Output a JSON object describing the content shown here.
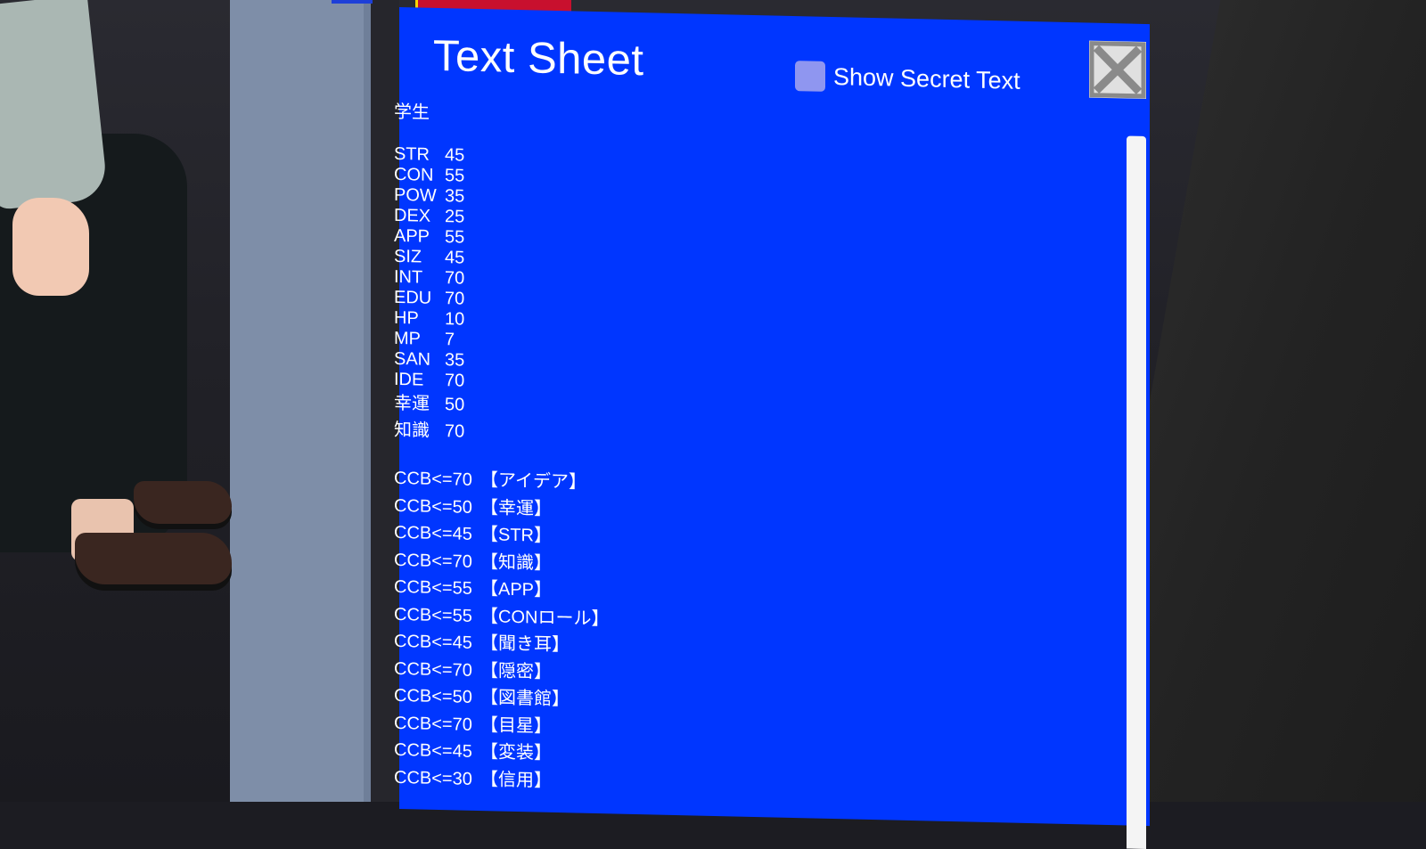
{
  "window": {
    "title": "Text Sheet",
    "secret_toggle_label": "Show Secret Text",
    "secret_toggle_checked": false,
    "close_icon": "close-x-icon"
  },
  "sheet": {
    "name": "学生",
    "stats": [
      {
        "key": "STR",
        "value": "45"
      },
      {
        "key": "CON",
        "value": "55"
      },
      {
        "key": "POW",
        "value": "35"
      },
      {
        "key": "DEX",
        "value": "25"
      },
      {
        "key": "APP",
        "value": "55"
      },
      {
        "key": "SIZ",
        "value": "45"
      },
      {
        "key": "INT",
        "value": "70"
      },
      {
        "key": "EDU",
        "value": "70"
      },
      {
        "key": "HP",
        "value": "10"
      },
      {
        "key": "MP",
        "value": "7"
      },
      {
        "key": "SAN",
        "value": "35"
      },
      {
        "key": "IDE",
        "value": "70"
      },
      {
        "key": "幸運",
        "value": "50"
      },
      {
        "key": "知識",
        "value": "70"
      }
    ],
    "checks": [
      {
        "cmd": "CCB<=70",
        "label": "【アイデア】"
      },
      {
        "cmd": "CCB<=50",
        "label": "【幸運】"
      },
      {
        "cmd": "CCB<=45",
        "label": "【STR】"
      },
      {
        "cmd": "CCB<=70",
        "label": "【知識】"
      },
      {
        "cmd": "CCB<=55",
        "label": "【APP】"
      },
      {
        "cmd": "CCB<=55",
        "label": "【CONロール】"
      },
      {
        "cmd": "CCB<=45",
        "label": "【聞き耳】"
      },
      {
        "cmd": "CCB<=70",
        "label": "【隠密】"
      },
      {
        "cmd": "CCB<=50",
        "label": "【図書館】"
      },
      {
        "cmd": "CCB<=70",
        "label": "【目星】"
      },
      {
        "cmd": "CCB<=45",
        "label": "【変装】"
      },
      {
        "cmd": "CCB<=30",
        "label": "【信用】"
      }
    ]
  },
  "colors": {
    "panel_bg": "#0036ff",
    "checkbox": "#8f96f0",
    "close_bg": "#e0e0e0",
    "close_x": "#8a8a8a"
  }
}
